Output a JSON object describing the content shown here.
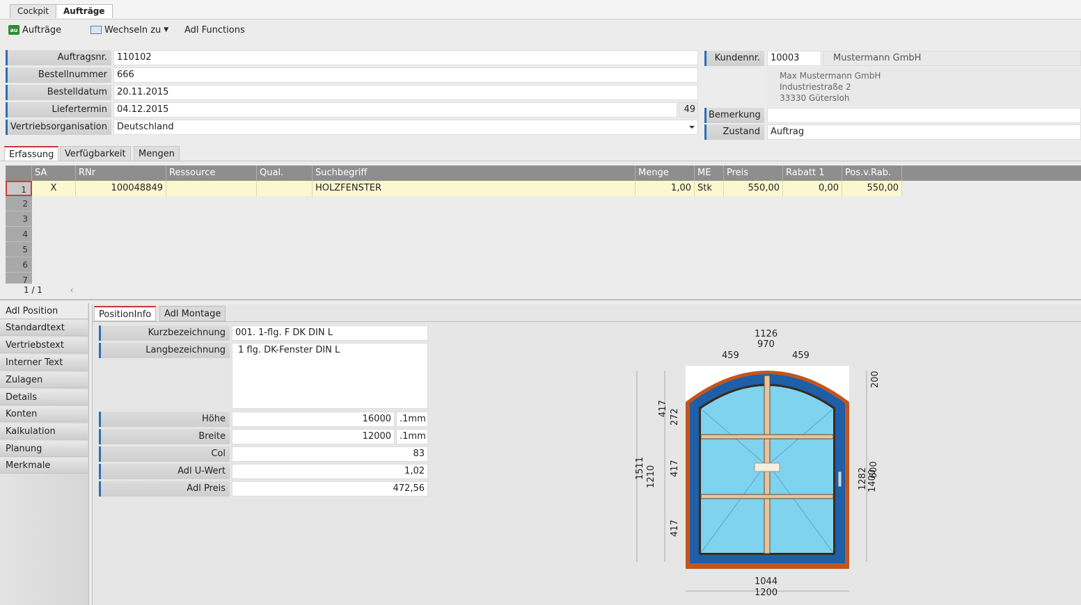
{
  "top_tabs": [
    "Cockpit",
    "Aufträge"
  ],
  "toolbar": {
    "orders_icon": "au",
    "orders_label": "Aufträge",
    "switch_label": "Wechseln zu",
    "functions_label": "Adl Functions"
  },
  "header_form": {
    "auftragsnr_label": "Auftragsnr.",
    "auftragsnr_value": "110102",
    "bestellnummer_label": "Bestellnummer",
    "bestellnummer_value": "666",
    "bestelldatum_label": "Bestelldatum",
    "bestelldatum_value": "20.11.2015",
    "liefertermin_label": "Liefertermin",
    "liefertermin_value": "04.12.2015",
    "liefertermin_week": "49",
    "vertrieb_label": "Vertriebsorganisation",
    "vertrieb_value": "Deutschland"
  },
  "customer": {
    "kundennr_label": "Kundennr.",
    "kundennr_value": "10003",
    "name": "Mustermann GmbH",
    "address_line1": "Max Mustermann GmbH",
    "address_line2": "Industriestraße 2",
    "address_line3": "33330 Gütersloh",
    "bemerkung_label": "Bemerkung",
    "bemerkung_value": "",
    "zustand_label": "Zustand",
    "zustand_value": "Auftrag"
  },
  "sub_tabs": [
    "Erfassung",
    "Verfügbarkeit",
    "Mengen"
  ],
  "grid": {
    "columns": [
      "SA",
      "RNr",
      "Ressource",
      "Qual.",
      "Suchbegriff",
      "Menge",
      "ME",
      "Preis",
      "Rabatt 1",
      "Pos.v.Rab."
    ],
    "rows": [
      {
        "num": "1",
        "sa": "X",
        "rnr": "100048849",
        "ressource": "",
        "qual": "",
        "suchbegriff": "HOLZFENSTER",
        "menge": "1,00",
        "me": "Stk",
        "preis": "550,00",
        "rabatt": "0,00",
        "posvrab": "550,00"
      }
    ],
    "row_numbers": [
      "1",
      "2",
      "3",
      "4",
      "5",
      "6",
      "7"
    ],
    "pager": "1 / 1"
  },
  "left_nav": [
    "Adl Position",
    "Standardtext",
    "Vertriebstext",
    "Interner Text",
    "Zulagen",
    "Details",
    "Konten",
    "Kalkulation",
    "Planung",
    "Merkmale"
  ],
  "panel_tabs": [
    "PositionInfo",
    "Adl Montage"
  ],
  "position": {
    "kurz_label": "Kurzbezeichnung",
    "kurz_value": "001. 1-flg. F DK DIN L",
    "lang_label": "Langbezeichnung",
    "lang_value": "1 flg. DK-Fenster DIN L",
    "hoehe_label": "Höhe",
    "hoehe_value": "16000",
    "hoehe_unit": ".1mm",
    "breite_label": "Breite",
    "breite_value": "12000",
    "breite_unit": ".1mm",
    "col_label": "Col",
    "col_value": "83",
    "uwert_label": "Adl U-Wert",
    "uwert_value": "1,02",
    "preis_label": "Adl Preis",
    "preis_value": "472,56"
  },
  "drawing_dims": {
    "top1": "1126",
    "top2": "970",
    "top_left": "459",
    "top_right": "459",
    "bottom1": "1044",
    "bottom2": "1200",
    "left_417a": "417",
    "left_272": "272",
    "left_417b": "417",
    "left_417c": "417",
    "left_1511": "1511",
    "left_1210": "1210",
    "right_200": "200",
    "right_1282": "1282",
    "right_1400": "1400",
    "right_600": "600"
  },
  "colors": {
    "accent_blue": "#2b6fb8",
    "frame_orange": "#c4541b",
    "frame_blue": "#1e5fa8",
    "glass": "#7fd3ee",
    "row_yellow": "#fbf8d0"
  }
}
